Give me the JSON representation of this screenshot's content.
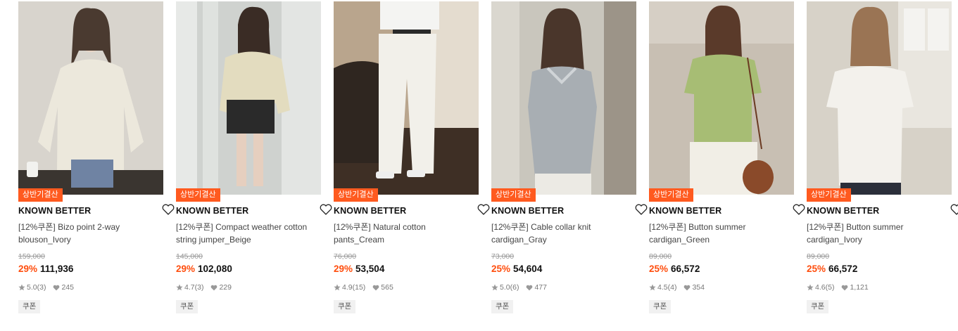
{
  "products": [
    {
      "badge": "상반기결산",
      "brand": "KNOWN BETTER",
      "name": "[12%쿠폰] Bizo point 2-way blouson_Ivory",
      "original_price": "159,000",
      "discount": "29%",
      "price": "111,936",
      "rating": "5.0",
      "reviews": "(3)",
      "likes": "245",
      "tag": "쿠폰",
      "colors": {
        "bg": "#d8d4cd",
        "garment": "#ece8dc",
        "lower": "#6f83a3"
      }
    },
    {
      "badge": "상반기결산",
      "brand": "KNOWN BETTER",
      "name": "[12%쿠폰] Compact weather cotton string jumper_Beige",
      "original_price": "145,000",
      "discount": "29%",
      "price": "102,080",
      "rating": "4.7",
      "reviews": "(3)",
      "likes": "229",
      "tag": "쿠폰",
      "colors": {
        "bg": "#cfd2cf",
        "garment": "#e3dcbf",
        "lower": "#2a2a2a"
      }
    },
    {
      "badge": "상반기결산",
      "brand": "KNOWN BETTER",
      "name": "[12%쿠폰] Natural cotton pants_Cream",
      "original_price": "76,000",
      "discount": "29%",
      "price": "53,504",
      "rating": "4.9",
      "reviews": "(15)",
      "likes": "565",
      "tag": "쿠폰",
      "colors": {
        "bg": "#b9a58d",
        "garment": "#f2f0ea",
        "lower": "#3e2f25"
      }
    },
    {
      "badge": "상반기결산",
      "brand": "KNOWN BETTER",
      "name": "[12%쿠폰] Cable collar knit cardigan_Gray",
      "original_price": "73,000",
      "discount": "25%",
      "price": "54,604",
      "rating": "5.0",
      "reviews": "(6)",
      "likes": "477",
      "tag": "쿠폰",
      "colors": {
        "bg": "#c9c6bd",
        "garment": "#a8aeb3",
        "lower": "#eceae4"
      }
    },
    {
      "badge": "상반기결산",
      "brand": "KNOWN BETTER",
      "name": "[12%쿠폰] Button summer cardigan_Green",
      "original_price": "89,000",
      "discount": "25%",
      "price": "66,572",
      "rating": "4.5",
      "reviews": "(4)",
      "likes": "354",
      "tag": "쿠폰",
      "colors": {
        "bg": "#c8bfb3",
        "garment": "#a7bd74",
        "lower": "#f1eee6"
      }
    },
    {
      "badge": "상반기결산",
      "brand": "KNOWN BETTER",
      "name": "[12%쿠폰] Button summer cardigan_Ivory",
      "original_price": "89,000",
      "discount": "25%",
      "price": "66,572",
      "rating": "4.6",
      "reviews": "(5)",
      "likes": "1,121",
      "tag": "쿠폰",
      "colors": {
        "bg": "#d7d2c8",
        "garment": "#f3f1ec",
        "lower": "#2b2f3a"
      }
    }
  ],
  "icons": {
    "wishlist": "heart-outline-icon",
    "rating": "star-icon",
    "likes": "heart-filled-icon"
  }
}
